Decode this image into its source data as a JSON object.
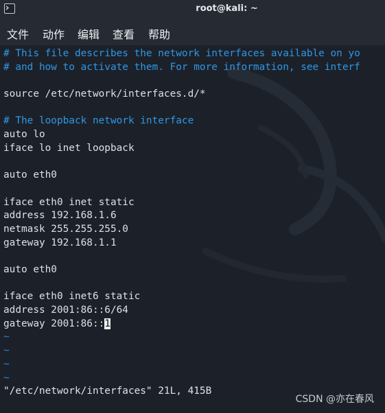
{
  "window": {
    "title": "root@kali: ~"
  },
  "menu": [
    {
      "label": "文件"
    },
    {
      "label": "动作"
    },
    {
      "label": "编辑"
    },
    {
      "label": "查看"
    },
    {
      "label": "帮助"
    }
  ],
  "editor": {
    "lines": [
      {
        "text": "# This file describes the network interfaces available on yo",
        "kind": "comment"
      },
      {
        "text": "# and how to activate them. For more information, see interf",
        "kind": "comment"
      },
      {
        "text": "",
        "kind": "normal"
      },
      {
        "text": "source /etc/network/interfaces.d/*",
        "kind": "normal"
      },
      {
        "text": "",
        "kind": "normal"
      },
      {
        "text": "# The loopback network interface",
        "kind": "comment"
      },
      {
        "text": "auto lo",
        "kind": "normal"
      },
      {
        "text": "iface lo inet loopback",
        "kind": "normal"
      },
      {
        "text": "",
        "kind": "normal"
      },
      {
        "text": "auto eth0",
        "kind": "normal"
      },
      {
        "text": "",
        "kind": "normal"
      },
      {
        "text": "iface eth0 inet static",
        "kind": "normal"
      },
      {
        "text": "address 192.168.1.6",
        "kind": "normal"
      },
      {
        "text": "netmask 255.255.255.0",
        "kind": "normal"
      },
      {
        "text": "gateway 192.168.1.1",
        "kind": "normal"
      },
      {
        "text": "",
        "kind": "normal"
      },
      {
        "text": "auto eth0",
        "kind": "normal"
      },
      {
        "text": "",
        "kind": "normal"
      },
      {
        "text": "iface eth0 inet6 static",
        "kind": "normal"
      },
      {
        "text": "address 2001:86::6/64",
        "kind": "normal"
      },
      {
        "text": "gateway 2001:86::",
        "kind": "normal",
        "cursor_char": "1"
      },
      {
        "text": "~",
        "kind": "tilde"
      },
      {
        "text": "~",
        "kind": "tilde"
      },
      {
        "text": "~",
        "kind": "tilde"
      },
      {
        "text": "~",
        "kind": "tilde"
      }
    ],
    "status_line": "\"/etc/network/interfaces\" 21L, 415B"
  },
  "watermark": "CSDN @亦在春风",
  "colors": {
    "background": "#1c2129",
    "titlebar": "#262b33",
    "comment": "#2f97e6",
    "text": "#dde1e6",
    "tilde": "#2f83d6"
  },
  "icons": {
    "app": "terminal-icon"
  }
}
